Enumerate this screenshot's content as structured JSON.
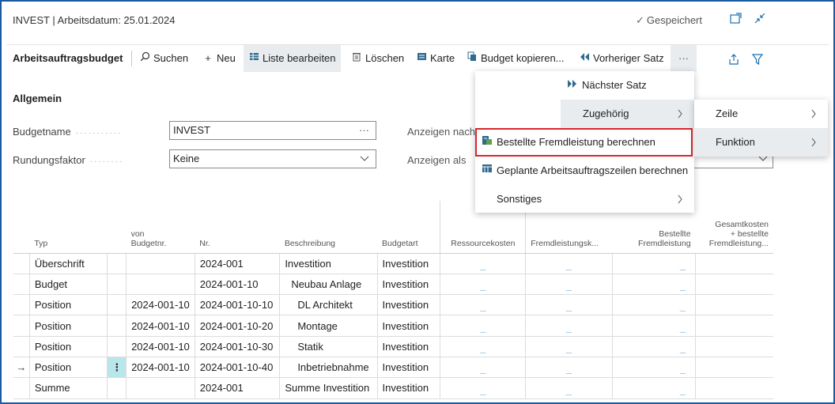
{
  "header": {
    "title": "INVEST | Arbeitsdatum: 25.01.2024",
    "saved_status": "Gespeichert"
  },
  "actionbar": {
    "page_name": "Arbeitsauftragsbudget",
    "search": "Suchen",
    "new": "Neu",
    "edit_list": "Liste bearbeiten",
    "delete": "Löschen",
    "card": "Karte",
    "copy_budget": "Budget kopieren...",
    "previous": "Vorheriger Satz",
    "more": "···"
  },
  "general": {
    "section_title": "Allgemein",
    "budget_name_label": "Budgetname",
    "budget_name_value": "INVEST",
    "budget_name_trail": "···",
    "rounding_label": "Rundungsfaktor",
    "rounding_value": "Keine",
    "show_by_label": "Anzeigen nach",
    "show_as_label": "Anzeigen als"
  },
  "table": {
    "headers": {
      "typ": "Typ",
      "von_budgetnr_1": "von",
      "von_budgetnr_2": "Budgetnr.",
      "nr": "Nr.",
      "beschreibung": "Beschreibung",
      "budgetart": "Budgetart",
      "ressourcekosten": "Ressourcekosten",
      "fremdleistung": "Fremdleistungsk...",
      "bestellte_1": "Bestellte",
      "bestellte_2": "Fremdleistung",
      "gesamt_1": "Gesamtkosten",
      "gesamt_2": "+ bestellte",
      "gesamt_3": "Fremdleistung..."
    },
    "rows": [
      {
        "arrow": "",
        "typ": "Überschrift",
        "von": "",
        "nr": "2024-001",
        "beschreibung": "Investition",
        "budgetart": "Investition"
      },
      {
        "arrow": "",
        "typ": "Budget",
        "von": "",
        "nr": "2024-001-10",
        "beschreibung": "Neubau Anlage",
        "budgetart": "Investition"
      },
      {
        "arrow": "",
        "typ": "Position",
        "von": "2024-001-10",
        "nr": "2024-001-10-10",
        "beschreibung": "DL Architekt",
        "budgetart": "Investition"
      },
      {
        "arrow": "",
        "typ": "Position",
        "von": "2024-001-10",
        "nr": "2024-001-10-20",
        "beschreibung": "Montage",
        "budgetart": "Investition"
      },
      {
        "arrow": "",
        "typ": "Position",
        "von": "2024-001-10",
        "nr": "2024-001-10-30",
        "beschreibung": "Statik",
        "budgetart": "Investition"
      },
      {
        "arrow": "→",
        "typ": "Position",
        "von": "2024-001-10",
        "nr": "2024-001-10-40",
        "beschreibung": "Inbetriebnahme",
        "budgetart": "Investition"
      },
      {
        "arrow": "",
        "typ": "Summe",
        "von": "",
        "nr": "2024-001",
        "beschreibung": "Summe Investition",
        "budgetart": "Investition"
      }
    ],
    "dash": "_",
    "row_handle": "⋮"
  },
  "menu_main": {
    "next_record": "Nächster Satz",
    "related": "Zugehörig",
    "calc_ordered": "Bestellte Fremdleistung berechnen",
    "calc_planned": "Geplante Arbeitsauftragszeilen berechnen",
    "misc": "Sonstiges"
  },
  "menu_related": {
    "line": "Zeile",
    "function": "Funktion"
  },
  "colors": {
    "accent": "#1a6fb0",
    "highlight_border": "#d9262b",
    "active_handle": "#b8e6ea",
    "hover_bg": "#e8ecef"
  }
}
